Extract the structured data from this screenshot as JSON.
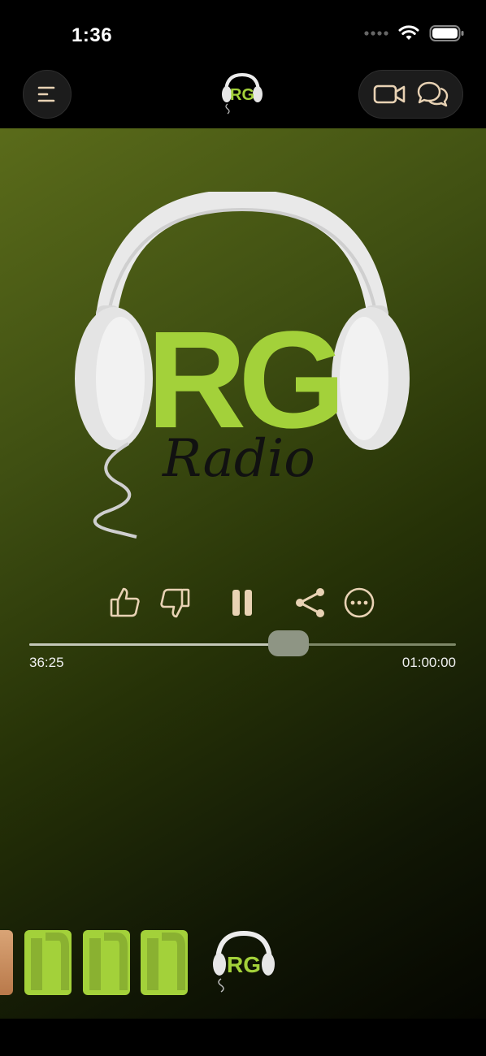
{
  "status_bar": {
    "time": "1:36"
  },
  "header": {
    "menu_icon": "menu-icon",
    "logo_text": "RG",
    "video_icon": "video-camera-icon",
    "chat_icon": "chat-bubbles-icon"
  },
  "artwork": {
    "logo_big": "RG",
    "script": "Radio"
  },
  "controls": {
    "like_icon": "thumbs-up-icon",
    "dislike_icon": "thumbs-down-icon",
    "pause_icon": "pause-icon",
    "share_icon": "share-icon",
    "more_icon": "more-icon"
  },
  "progress": {
    "current": "36:25",
    "total": "01:00:00",
    "fraction": 0.607
  },
  "colors": {
    "accent": "#a3d13a",
    "icon": "#e8d2b4",
    "background": "#000000"
  }
}
